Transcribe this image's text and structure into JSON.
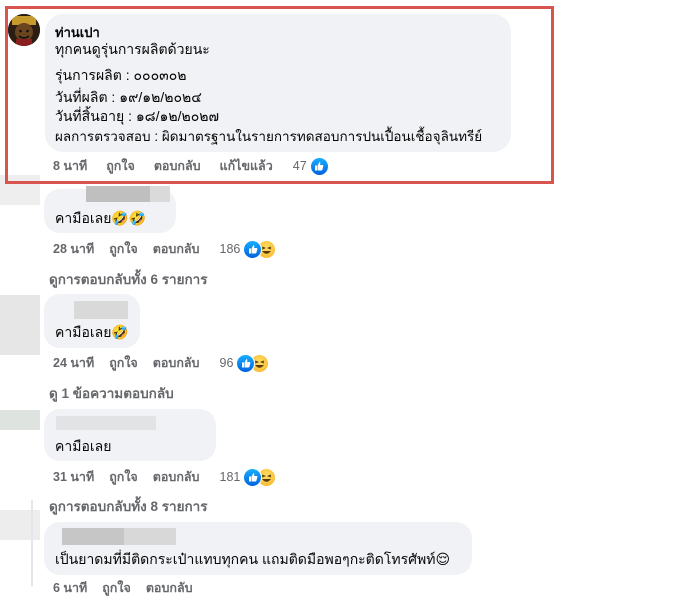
{
  "comments": [
    {
      "author": "ท่านเปา",
      "lines": [
        "ทุกคนดูรุ่นการผลิตด้วยนะ",
        "",
        "รุ่นการผลิต : ๐๐๐๓๐๒",
        "วันที่ผลิต : ๑๙/๑๒/๒๐๒๔",
        "วันที่สิ้นอายุ : ๑๘/๑๒/๒๐๒๗",
        "ผลการตรวจสอบ : ผิดมาตรฐานในรายการทดสอบการปนเปื้อนเชื้อจุลินทรีย์"
      ],
      "time": "8 นาที",
      "like": "ถูกใจ",
      "reply": "ตอบกลับ",
      "edited": "แก้ไขแล้ว",
      "reactions": "47"
    },
    {
      "text": "คามือเลย🤣🤣",
      "time": "28 นาที",
      "like": "ถูกใจ",
      "reply": "ตอบกลับ",
      "reactions": "186",
      "view_replies": "ดูการตอบกลับทั้ง 6 รายการ"
    },
    {
      "text": "คามือเลย🤣",
      "time": "24 นาที",
      "like": "ถูกใจ",
      "reply": "ตอบกลับ",
      "reactions": "96",
      "view_replies": "ดู 1 ข้อความตอบกลับ"
    },
    {
      "text": "คามือเลย",
      "time": "31 นาที",
      "like": "ถูกใจ",
      "reply": "ตอบกลับ",
      "reactions": "181",
      "view_replies": "ดูการตอบกลับทั้ง 8 รายการ"
    },
    {
      "text": "เป็นยาดมที่มีติดกระเป๋าแทบทุกคน แถมติดมือพอๆกะติดโทรศัพท์😌",
      "time": "6 นาที",
      "like": "ถูกใจ",
      "reply": "ตอบกลับ"
    }
  ],
  "colors": {
    "highlight": "#d9534f",
    "bubble": "#f0f2f5",
    "meta": "#65676b",
    "like_blue": "#0866ff"
  },
  "icons": [
    "avatar",
    "like-reaction-icon",
    "haha-reaction-icon"
  ]
}
